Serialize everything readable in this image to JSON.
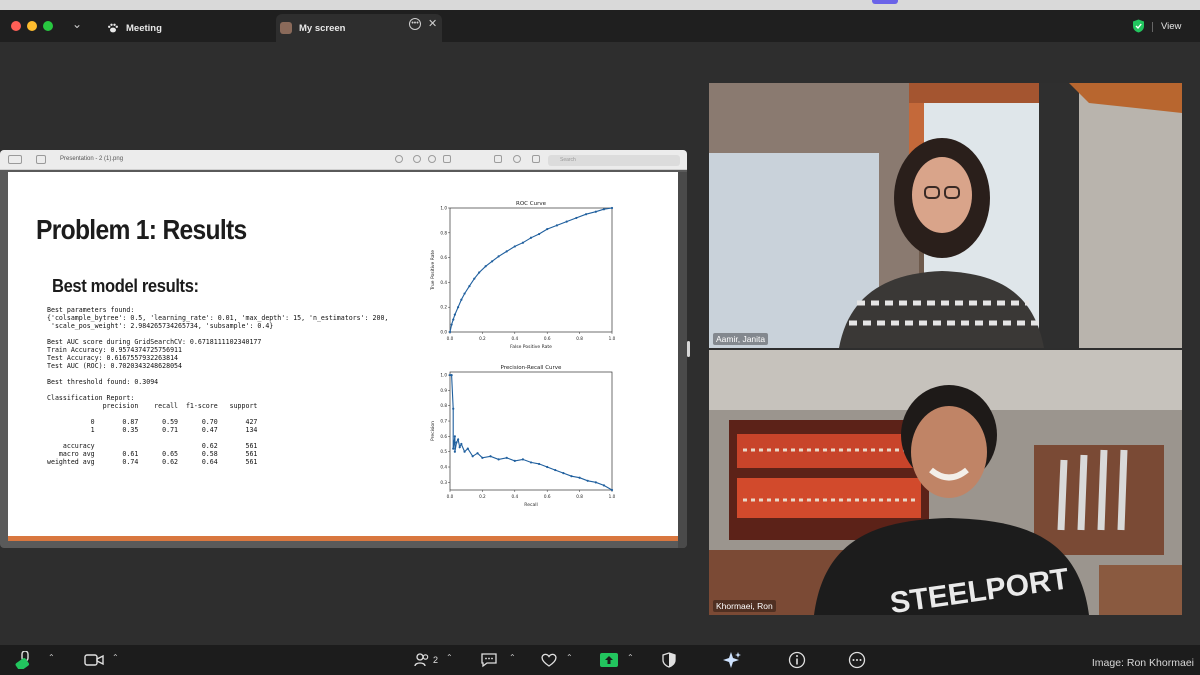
{
  "tabs": {
    "meeting_label": "Meeting",
    "screen_label": "My screen",
    "view_label": "View"
  },
  "shared_window": {
    "filename": "Presentation - 2 (1).png",
    "search_placeholder": "Search"
  },
  "slide": {
    "title": "Problem 1: Results",
    "subtitle": "Best model results:",
    "code_lines": [
      "Best parameters found:",
      "{'colsample_bytree': 0.5, 'learning_rate': 0.01, 'max_depth': 15, 'n_estimators': 200,",
      " 'scale_pos_weight': 2.984265734265734, 'subsample': 0.4}",
      "",
      "Best AUC score during GridSearchCV: 0.6718111102340177",
      "Train Accuracy: 0.9574374725756911",
      "Test Accuracy: 0.6167557932263814",
      "Test AUC (ROC): 0.7020343248628054",
      "",
      "Best threshold found: 0.3094",
      "",
      "Classification Report:",
      "              precision    recall  f1-score   support",
      "",
      "           0       0.87      0.59      0.70       427",
      "           1       0.35      0.71      0.47       134",
      "",
      "    accuracy                           0.62       561",
      "   macro avg       0.61      0.65      0.58       561",
      "weighted avg       0.74      0.62      0.64       561"
    ]
  },
  "chart_data": [
    {
      "type": "line",
      "title": "ROC Curve",
      "xlabel": "False Positive Rate",
      "ylabel": "True Positive Rate",
      "xlim": [
        0,
        1
      ],
      "ylim": [
        0,
        1
      ],
      "xticks": [
        "0.0",
        "0.2",
        "0.4",
        "0.6",
        "0.8",
        "1.0"
      ],
      "yticks": [
        "0.0",
        "0.2",
        "0.4",
        "0.6",
        "0.8",
        "1.0"
      ],
      "x": [
        0.0,
        0.01,
        0.02,
        0.03,
        0.05,
        0.07,
        0.09,
        0.12,
        0.15,
        0.18,
        0.22,
        0.26,
        0.3,
        0.35,
        0.4,
        0.45,
        0.5,
        0.55,
        0.6,
        0.66,
        0.72,
        0.78,
        0.84,
        0.9,
        0.95,
        1.0
      ],
      "y": [
        0.0,
        0.06,
        0.1,
        0.14,
        0.2,
        0.26,
        0.31,
        0.37,
        0.43,
        0.48,
        0.53,
        0.57,
        0.61,
        0.65,
        0.69,
        0.72,
        0.76,
        0.79,
        0.83,
        0.86,
        0.89,
        0.92,
        0.95,
        0.97,
        0.99,
        1.0
      ]
    },
    {
      "type": "line",
      "title": "Precision-Recall Curve",
      "xlabel": "Recall",
      "ylabel": "Precision",
      "xlim": [
        0,
        1
      ],
      "ylim": [
        0.25,
        1.02
      ],
      "xticks": [
        "0.0",
        "0.2",
        "0.4",
        "0.6",
        "0.8",
        "1.0"
      ],
      "yticks": [
        "0.3",
        "0.4",
        "0.5",
        "0.6",
        "0.7",
        "0.8",
        "0.9",
        "1.0"
      ],
      "x": [
        0.0,
        0.01,
        0.02,
        0.02,
        0.03,
        0.03,
        0.04,
        0.05,
        0.06,
        0.07,
        0.09,
        0.11,
        0.14,
        0.17,
        0.2,
        0.25,
        0.3,
        0.35,
        0.4,
        0.45,
        0.5,
        0.55,
        0.6,
        0.65,
        0.7,
        0.75,
        0.8,
        0.85,
        0.9,
        0.95,
        1.0
      ],
      "y": [
        1.0,
        1.0,
        0.78,
        0.52,
        0.6,
        0.5,
        0.56,
        0.58,
        0.53,
        0.55,
        0.5,
        0.52,
        0.47,
        0.49,
        0.46,
        0.47,
        0.45,
        0.46,
        0.44,
        0.45,
        0.43,
        0.42,
        0.4,
        0.38,
        0.36,
        0.34,
        0.33,
        0.31,
        0.3,
        0.28,
        0.25
      ]
    }
  ],
  "participants": [
    {
      "name": "Aamir, Janita"
    },
    {
      "name": "Khormaei, Ron"
    }
  ],
  "toolbar": {
    "participants_count": "2"
  },
  "credit": "Image: Ron Khormaei",
  "colors": {
    "accent_green": "#22c55e",
    "slide_accent": "#d9773f",
    "curve_blue": "#1f5f9e"
  }
}
